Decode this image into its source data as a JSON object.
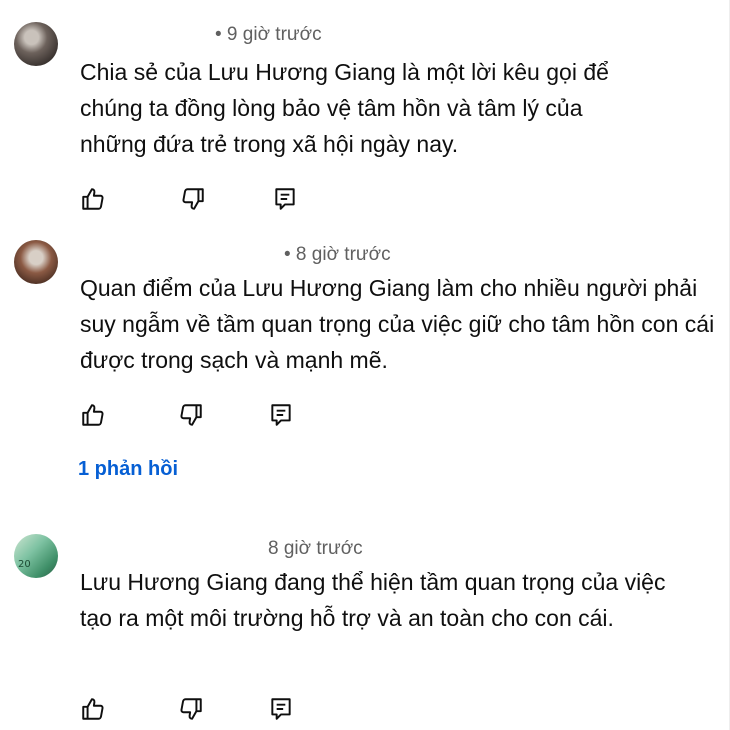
{
  "comments": [
    {
      "time": "• 9 giờ trước",
      "text": "Chia sẻ của Lưu Hương Giang là một lời kêu gọi để chúng ta đồng lòng bảo vệ tâm hồn và tâm lý của những đứa trẻ trong xã hội ngày nay."
    },
    {
      "time": "• 8 giờ trước",
      "text": "Quan điểm của Lưu Hương Giang làm cho nhiều người phải suy ngẫm về tầm quan trọng của việc giữ cho tâm hồn con cái được trong sạch và mạnh mẽ.",
      "replies": "1 phản hồi"
    },
    {
      "time": "8 giờ trước",
      "text": "Lưu Hương Giang đang thể hiện tầm quan trọng của việc tạo ra một môi trường hỗ trợ và an toàn cho con cái.",
      "avatar_label": "20"
    }
  ],
  "icons": {
    "like": "thumb-up-icon",
    "dislike": "thumb-down-icon",
    "reply": "comment-reply-icon"
  }
}
